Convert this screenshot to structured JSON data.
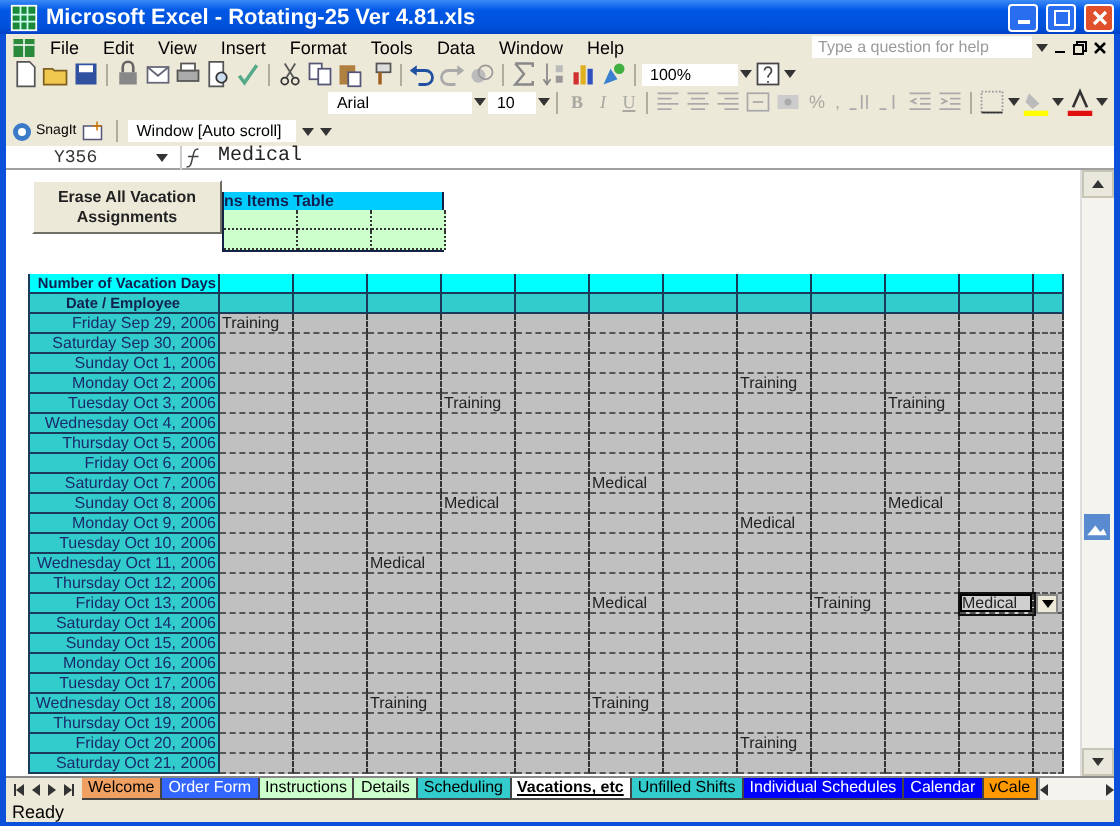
{
  "window": {
    "title": "Microsoft Excel - Rotating-25 Ver 4.81.xls"
  },
  "menu": [
    "File",
    "Edit",
    "View",
    "Insert",
    "Format",
    "Tools",
    "Data",
    "Window",
    "Help"
  ],
  "help_box": {
    "placeholder": "Type a question for help"
  },
  "standard_toolbar": {
    "zoom": "100%"
  },
  "formatting_toolbar": {
    "font": "Arial",
    "size": "10",
    "style_buttons": [
      {
        "kind": "bold",
        "label": "B"
      },
      {
        "kind": "italic",
        "label": "I"
      },
      {
        "kind": "underline",
        "label": "U"
      }
    ],
    "number_buttons": [
      "%",
      ","
    ]
  },
  "snagit_toolbar": {
    "button": "SnagIt",
    "profile": "Window [Auto scroll]"
  },
  "formula_bar": {
    "name_box": "Y356",
    "value": "Medical"
  },
  "sheet": {
    "erase_button": "Erase All Vacation Assignments",
    "items_table_title": "ns Items Table",
    "vacation_days_label": "Number of Vacation Days",
    "header_label": "Date / Employee",
    "rows": [
      {
        "date": "Friday Sep 29, 2006",
        "cells": [
          {
            "text": "Training",
            "selected": false
          },
          null,
          null,
          null,
          null,
          null,
          null,
          null,
          null,
          null,
          null,
          null
        ]
      },
      {
        "date": "Saturday Sep 30, 2006",
        "cells": [
          null,
          null,
          null,
          null,
          null,
          null,
          null,
          null,
          null,
          null,
          null,
          null
        ]
      },
      {
        "date": "Sunday Oct 1, 2006",
        "cells": [
          null,
          null,
          null,
          null,
          null,
          null,
          null,
          null,
          null,
          null,
          null,
          null
        ]
      },
      {
        "date": "Monday Oct 2, 2006",
        "cells": [
          null,
          null,
          null,
          null,
          null,
          null,
          null,
          {
            "text": "Training",
            "selected": false
          },
          null,
          null,
          null,
          null
        ]
      },
      {
        "date": "Tuesday Oct 3, 2006",
        "cells": [
          null,
          null,
          null,
          {
            "text": "Training",
            "selected": false
          },
          null,
          null,
          null,
          null,
          null,
          {
            "text": "Training",
            "selected": false
          },
          null,
          null
        ]
      },
      {
        "date": "Wednesday Oct 4, 2006",
        "cells": [
          null,
          null,
          null,
          null,
          null,
          null,
          null,
          null,
          null,
          null,
          null,
          null
        ]
      },
      {
        "date": "Thursday Oct 5, 2006",
        "cells": [
          null,
          null,
          null,
          null,
          null,
          null,
          null,
          null,
          null,
          null,
          null,
          null
        ]
      },
      {
        "date": "Friday Oct 6, 2006",
        "cells": [
          null,
          null,
          null,
          null,
          null,
          null,
          null,
          null,
          null,
          null,
          null,
          null
        ]
      },
      {
        "date": "Saturday Oct 7, 2006",
        "cells": [
          null,
          null,
          null,
          null,
          null,
          {
            "text": "Medical",
            "selected": false
          },
          null,
          null,
          null,
          null,
          null,
          null
        ]
      },
      {
        "date": "Sunday Oct 8, 2006",
        "cells": [
          null,
          null,
          null,
          {
            "text": "Medical",
            "selected": false
          },
          null,
          null,
          null,
          null,
          null,
          {
            "text": "Medical",
            "selected": false
          },
          null,
          null
        ]
      },
      {
        "date": "Monday Oct 9, 2006",
        "cells": [
          null,
          null,
          null,
          null,
          null,
          null,
          null,
          {
            "text": "Medical",
            "selected": false
          },
          null,
          null,
          null,
          null
        ]
      },
      {
        "date": "Tuesday Oct 10, 2006",
        "cells": [
          null,
          null,
          null,
          null,
          null,
          null,
          null,
          null,
          null,
          null,
          null,
          null
        ]
      },
      {
        "date": "Wednesday Oct 11, 2006",
        "cells": [
          null,
          null,
          {
            "text": "Medical",
            "selected": false
          },
          null,
          null,
          null,
          null,
          null,
          null,
          null,
          null,
          null
        ]
      },
      {
        "date": "Thursday Oct 12, 2006",
        "cells": [
          null,
          null,
          null,
          null,
          null,
          null,
          null,
          null,
          null,
          null,
          null,
          null
        ]
      },
      {
        "date": "Friday Oct 13, 2006",
        "cells": [
          null,
          null,
          null,
          null,
          null,
          {
            "text": "Medical",
            "selected": false
          },
          null,
          null,
          {
            "text": "Training",
            "selected": false
          },
          null,
          {
            "text": "Medical",
            "selected": true
          },
          null
        ]
      },
      {
        "date": "Saturday Oct 14, 2006",
        "cells": [
          null,
          null,
          null,
          null,
          null,
          null,
          null,
          null,
          null,
          null,
          null,
          null
        ]
      },
      {
        "date": "Sunday Oct 15, 2006",
        "cells": [
          null,
          null,
          null,
          null,
          null,
          null,
          null,
          null,
          null,
          null,
          null,
          null
        ]
      },
      {
        "date": "Monday Oct 16, 2006",
        "cells": [
          null,
          null,
          null,
          null,
          null,
          null,
          null,
          null,
          null,
          null,
          null,
          null
        ]
      },
      {
        "date": "Tuesday Oct 17, 2006",
        "cells": [
          null,
          null,
          null,
          null,
          null,
          null,
          null,
          null,
          null,
          null,
          null,
          null
        ]
      },
      {
        "date": "Wednesday Oct 18, 2006",
        "cells": [
          null,
          null,
          {
            "text": "Training",
            "selected": false
          },
          null,
          null,
          {
            "text": "Training",
            "selected": false
          },
          null,
          null,
          null,
          null,
          null,
          null
        ]
      },
      {
        "date": "Thursday Oct 19, 2006",
        "cells": [
          null,
          null,
          null,
          null,
          null,
          null,
          null,
          null,
          null,
          null,
          null,
          null
        ]
      },
      {
        "date": "Friday Oct 20, 2006",
        "cells": [
          null,
          null,
          null,
          null,
          null,
          null,
          null,
          {
            "text": "Training",
            "selected": false
          },
          null,
          null,
          null,
          null
        ]
      },
      {
        "date": "Saturday Oct 21, 2006",
        "cells": [
          null,
          null,
          null,
          null,
          null,
          null,
          null,
          null,
          null,
          null,
          null,
          null
        ]
      }
    ]
  },
  "sheet_tabs": [
    {
      "label": "Welcome",
      "selected": false,
      "color": "#f0a060"
    },
    {
      "label": "Order Form",
      "selected": false,
      "color": "#3366ff"
    },
    {
      "label": "Instructions",
      "selected": false,
      "color": "#ccffcc"
    },
    {
      "label": "Details",
      "selected": false,
      "color": "#ccffcc"
    },
    {
      "label": "Scheduling",
      "selected": false,
      "color": "#33cccc"
    },
    {
      "label": "Vacations, etc",
      "selected": true,
      "color": "#ffffff"
    },
    {
      "label": "Unfilled Shifts",
      "selected": false,
      "color": "#33cccc"
    },
    {
      "label": "Individual Schedules",
      "selected": false,
      "color": "#0000ff"
    },
    {
      "label": "Calendar",
      "selected": false,
      "color": "#0000ff"
    },
    {
      "label": "vCale",
      "selected": false,
      "color": "#ff9900"
    }
  ],
  "status_bar": {
    "text": "Ready"
  }
}
